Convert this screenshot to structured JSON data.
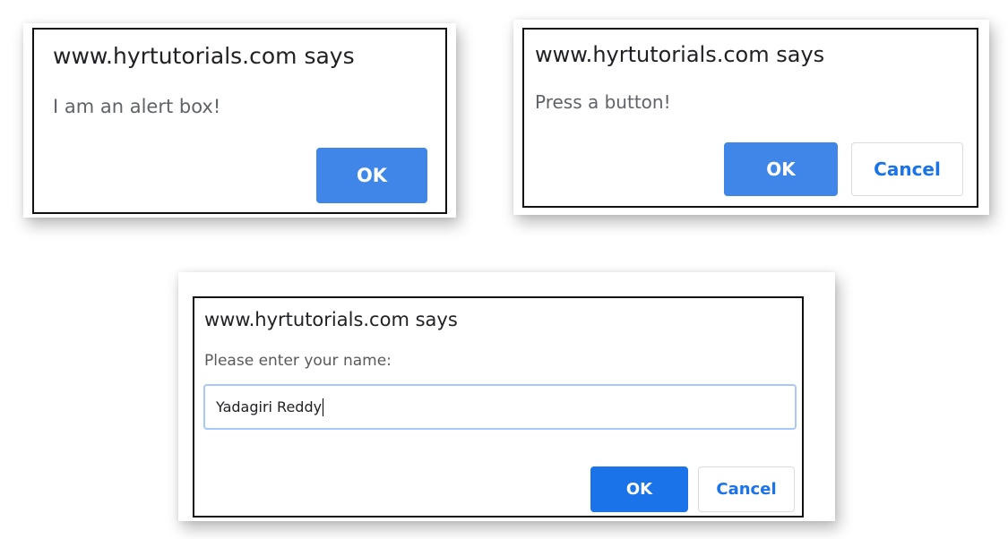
{
  "alert_dialog": {
    "title": "www.hyrtutorials.com says",
    "message": "I am an alert box!",
    "ok_label": "OK"
  },
  "confirm_dialog": {
    "title": "www.hyrtutorials.com says",
    "message": "Press a button!",
    "ok_label": "OK",
    "cancel_label": "Cancel"
  },
  "prompt_dialog": {
    "title": "www.hyrtutorials.com says",
    "message": "Please enter your name:",
    "input_value": "Yadagiri Reddy",
    "ok_label": "OK",
    "cancel_label": "Cancel"
  },
  "colors": {
    "ok_button": "#3f86e8",
    "cancel_text": "#1a73e8",
    "input_focus_border": "#a8c7fa"
  }
}
